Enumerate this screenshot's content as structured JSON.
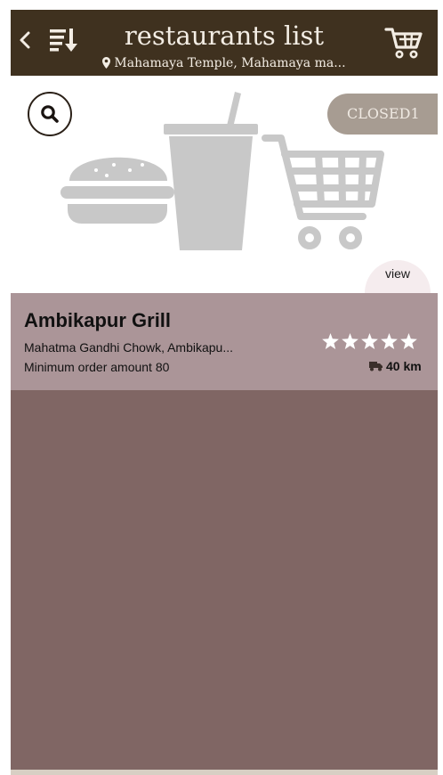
{
  "header": {
    "title": "restaurants list",
    "location": "Mahamaya Temple, Mahamaya ma..."
  },
  "restaurant": {
    "status_badge": "CLOSED1",
    "view_label": "view",
    "name": "Ambikapur Grill",
    "address": "Mahatma Gandhi Chowk, Ambikapu...",
    "min_order": "Minimum order amount 80",
    "rating": 5,
    "rating_max": 5,
    "distance": "40 km"
  },
  "colors": {
    "header_bg": "#3f311f",
    "card_bg": "#ab9598",
    "list_bg": "#806664",
    "badge_bg": "#a79c92"
  },
  "icons": [
    "back-icon",
    "sort-icon",
    "cart-icon",
    "location-pin-icon",
    "search-icon",
    "star-icon",
    "truck-icon"
  ]
}
